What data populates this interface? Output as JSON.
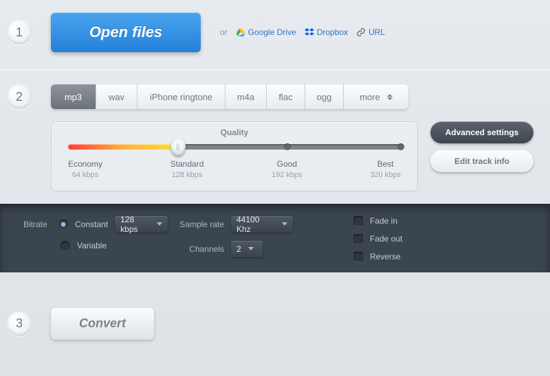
{
  "step1": {
    "badge": "1",
    "open_label": "Open files",
    "or": "or",
    "sources": {
      "gdrive": "Google Drive",
      "dropbox": "Dropbox",
      "url": "URL"
    }
  },
  "step2": {
    "badge": "2",
    "formats": [
      "mp3",
      "wav",
      "iPhone ringtone",
      "m4a",
      "flac",
      "ogg",
      "more"
    ],
    "quality_title": "Quality",
    "quality_levels": [
      {
        "name": "Economy",
        "rate": "64 kbps"
      },
      {
        "name": "Standard",
        "rate": "128 kbps"
      },
      {
        "name": "Good",
        "rate": "192 kbps"
      },
      {
        "name": "Best",
        "rate": "320 kbps"
      }
    ],
    "advanced_btn": "Advanced settings",
    "edit_btn": "Edit track info"
  },
  "advanced": {
    "bitrate_label": "Bitrate",
    "bitrate_mode": {
      "constant": "Constant",
      "variable": "Variable"
    },
    "bitrate_value": "128 kbps",
    "samplerate_label": "Sample rate",
    "samplerate_value": "44100 Khz",
    "channels_label": "Channels",
    "channels_value": "2",
    "fade_in": "Fade in",
    "fade_out": "Fade out",
    "reverse": "Reverse"
  },
  "step3": {
    "badge": "3",
    "convert_label": "Convert"
  }
}
